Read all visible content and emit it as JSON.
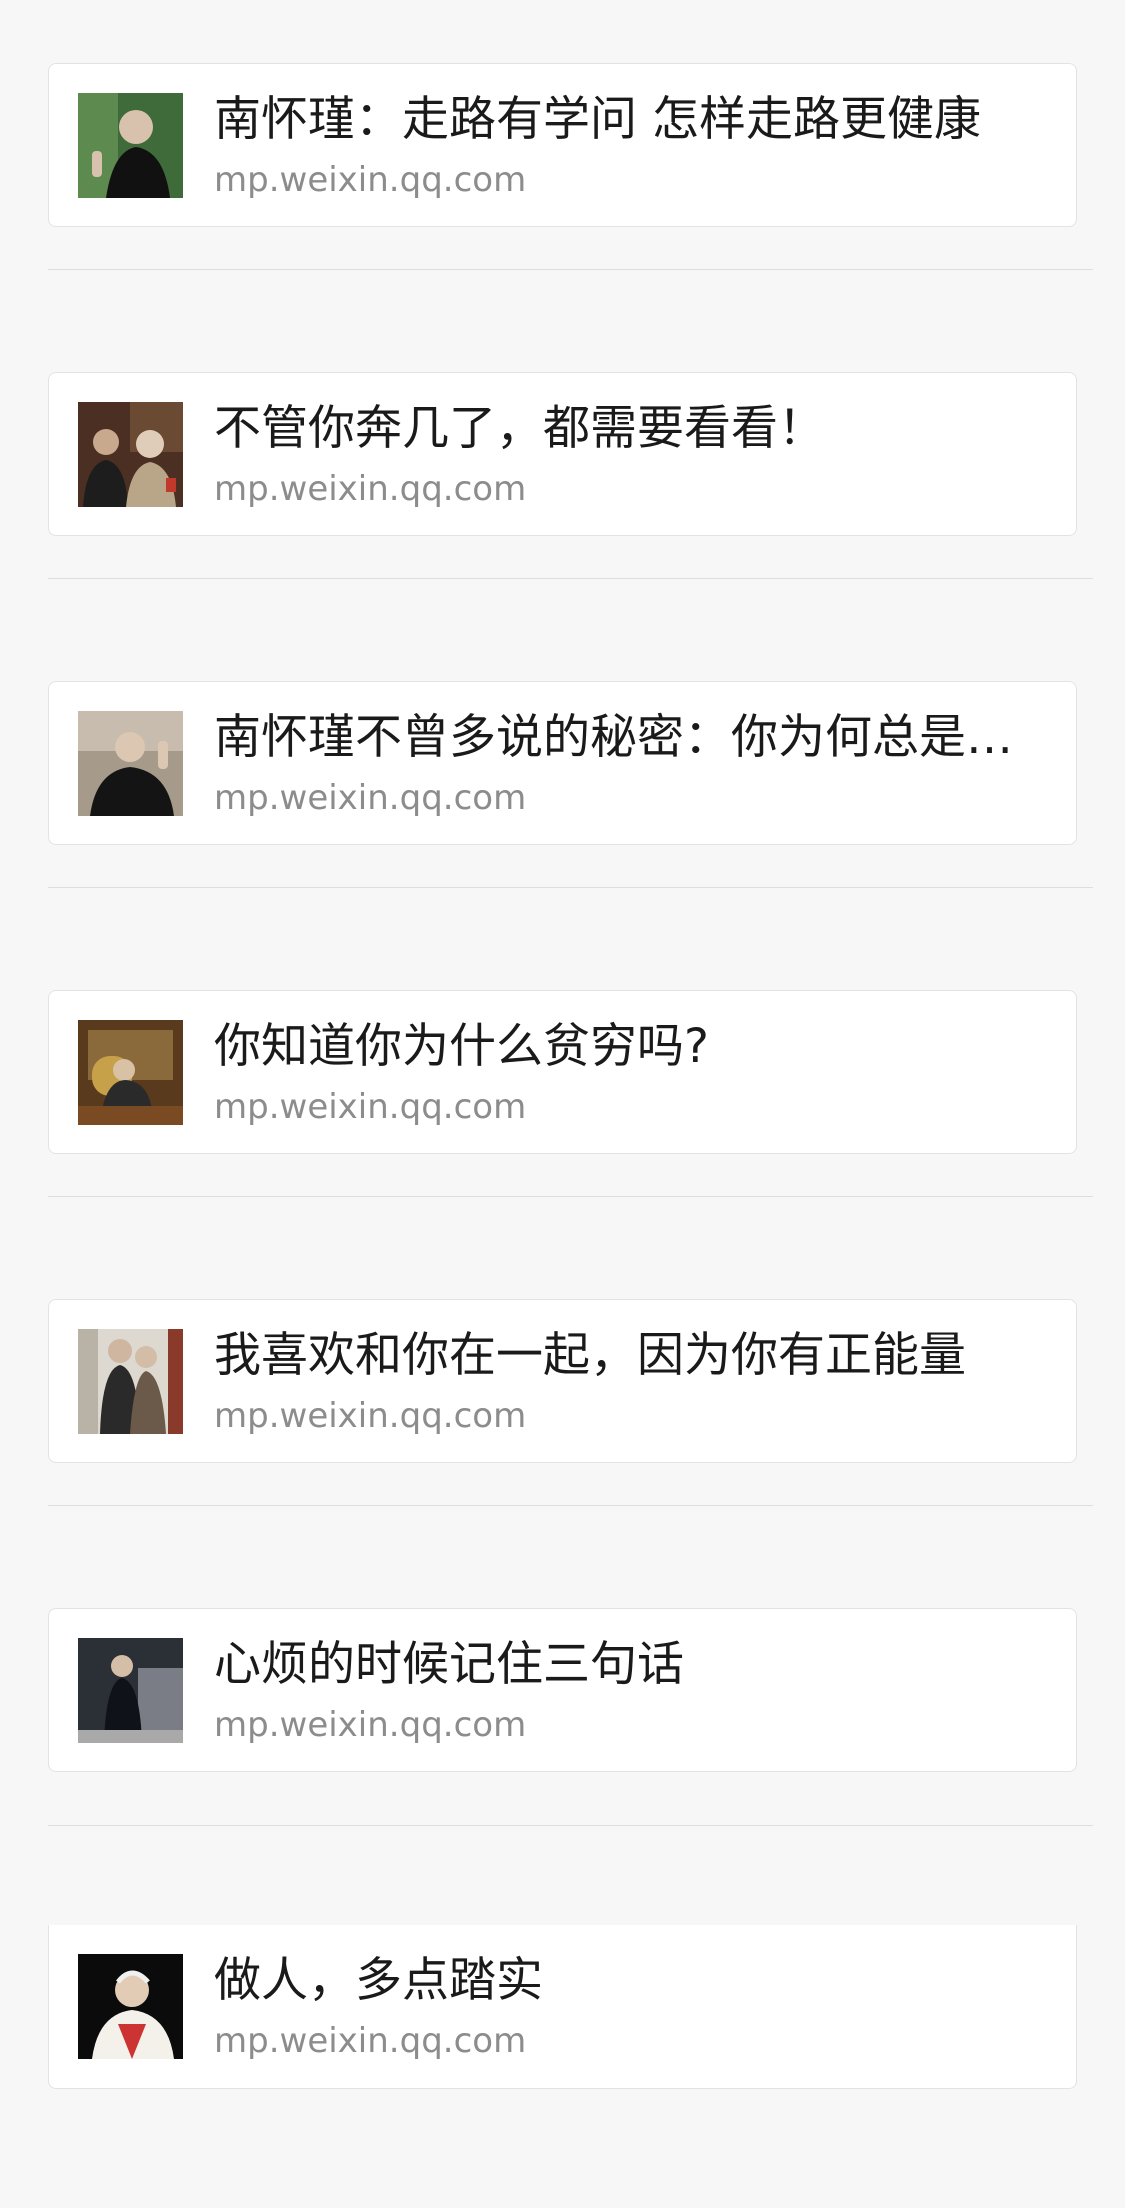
{
  "feed": {
    "items": [
      {
        "title": "南怀瑾：走路有学问 怎样走路更健康",
        "source": "mp.weixin.qq.com",
        "thumb_icon": "elderly-man-photo-icon"
      },
      {
        "title": "不管你奔几了，都需要看看！",
        "source": "mp.weixin.qq.com",
        "thumb_icon": "two-men-photo-icon"
      },
      {
        "title": "南怀瑾不曾多说的秘密：你为何总是……",
        "source": "mp.weixin.qq.com",
        "thumb_icon": "elderly-man-photo-icon"
      },
      {
        "title": "你知道你为什么贫穷吗?",
        "source": "mp.weixin.qq.com",
        "thumb_icon": "man-seated-photo-icon"
      },
      {
        "title": "我喜欢和你在一起，因为你有正能量",
        "source": "mp.weixin.qq.com",
        "thumb_icon": "two-men-photo-icon"
      },
      {
        "title": "心烦的时候记住三句话",
        "source": "mp.weixin.qq.com",
        "thumb_icon": "man-standing-photo-icon"
      },
      {
        "title": "做人，多点踏实",
        "source": "mp.weixin.qq.com",
        "thumb_icon": "elderly-man-photo-icon"
      }
    ]
  }
}
